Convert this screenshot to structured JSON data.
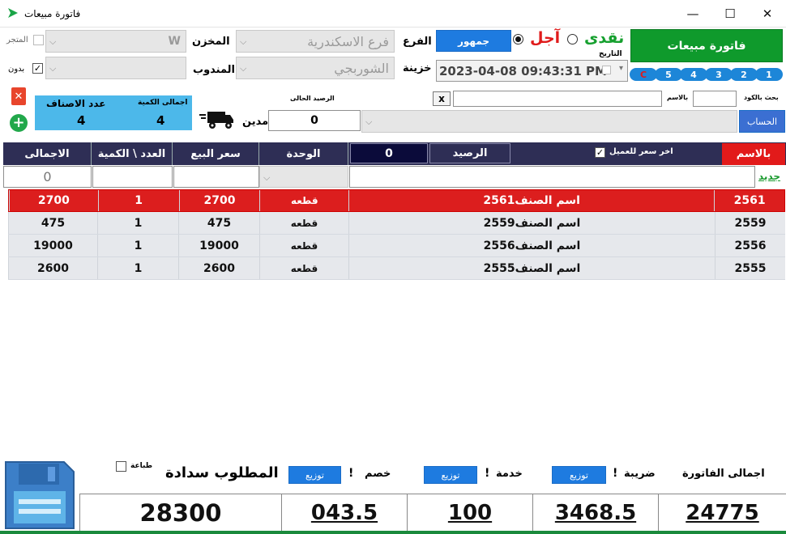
{
  "window": {
    "title": "فاتورة مبيعات",
    "minimize": "—",
    "maximize": "☐",
    "close": "✕"
  },
  "top": {
    "store_label": "المتجر",
    "warehouse_label": "المخزن",
    "warehouse_value": "W",
    "branch_label": "الفرع",
    "branch_value": "فرع الاسكندرية",
    "rep_label": "المندوب",
    "without_label": "بدون",
    "safe_label": "خزينة",
    "safe_value": "الشوربجي",
    "public_button": "جمهور",
    "deferred_label": "آجل",
    "cash_label": "نقدى",
    "invoice_button": "فاتورة مبيعات",
    "date_label": "التاريخ",
    "date_value": "2023-04-08 09:43:31 PM",
    "clouds": [
      "1",
      "2",
      "3",
      "4",
      "5",
      "C"
    ]
  },
  "summary": {
    "items_count_label": "عدد الاصناف",
    "items_count_value": "4",
    "total_qty_label": "اجمالى الكمية",
    "total_qty_value": "4"
  },
  "account": {
    "current_balance_label": "الرصيد الحالى",
    "current_balance_value": "0",
    "debtor_label": "مدين",
    "by_name_label": "بالاسم",
    "by_code_label": "بحث بالكود",
    "clear_button": "x",
    "account_button": "الحساب"
  },
  "grid_header": {
    "by_name": "بالاسم",
    "last_price_label": "اخر سعر للعميل",
    "balance_label": "الرصيد",
    "balance_value": "0",
    "unit": "الوحدة",
    "price": "سعر البيع",
    "qty": "العدد \\ الكمية",
    "total": "الاجمالى",
    "new_link": "جديد",
    "entry_total": "0"
  },
  "rows": [
    {
      "code": "2561",
      "name": "2561اسم الصنف",
      "unit": "قطعه",
      "price": "2700",
      "qty": "1",
      "total": "2700"
    },
    {
      "code": "2559",
      "name": "2559اسم الصنف",
      "unit": "قطعه",
      "price": "475",
      "qty": "1",
      "total": "475"
    },
    {
      "code": "2556",
      "name": "2556اسم الصنف",
      "unit": "قطعه",
      "price": "19000",
      "qty": "1",
      "total": "19000"
    },
    {
      "code": "2555",
      "name": "2555اسم الصنف",
      "unit": "قطعه",
      "price": "2600",
      "qty": "1",
      "total": "2600"
    }
  ],
  "footer": {
    "invoice_total_label": "اجمالى الفاتورة",
    "tax_label": "ضريبة",
    "service_label": "خدمة",
    "discount_label": "خصم",
    "required_label": "المطلوب سدادة",
    "print_label": "طباعة",
    "distribute": "توزيع",
    "bang": "!",
    "invoice_total_value": "24775",
    "tax_value": "3468.5",
    "service_value": "100",
    "discount_value": "043.5",
    "required_value": "28300"
  },
  "colors": {
    "accent": "#1e7be0",
    "header": "#2e2e55",
    "highlight_row": "#dc1e1e",
    "invoice_button": "#0f9a2c"
  }
}
